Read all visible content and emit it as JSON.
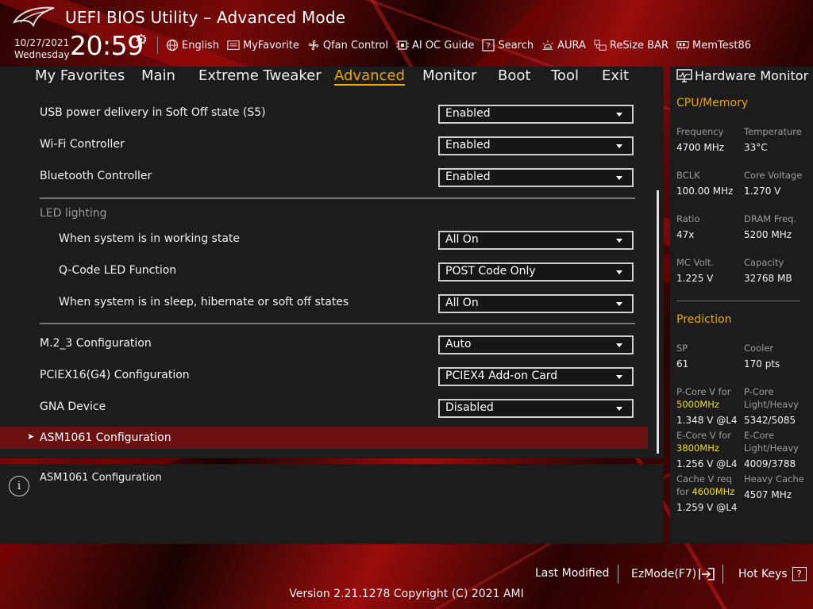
{
  "app": {
    "title": "UEFI BIOS Utility – Advanced Mode"
  },
  "datetime": {
    "date": "10/27/2021",
    "day": "Wednesday",
    "time": "20:59"
  },
  "toolbar": [
    {
      "label": "English",
      "icon": "globe-icon"
    },
    {
      "label": "MyFavorite",
      "icon": "favorite-list-icon"
    },
    {
      "label": "Qfan Control",
      "icon": "fan-icon"
    },
    {
      "label": "AI OC Guide",
      "icon": "chip-icon"
    },
    {
      "label": "Search",
      "icon": "search-help-icon"
    },
    {
      "label": "AURA",
      "icon": "aura-light-icon"
    },
    {
      "label": "ReSize BAR",
      "icon": "resize-bar-icon"
    },
    {
      "label": "MemTest86",
      "icon": "memory-icon"
    }
  ],
  "tabs": [
    {
      "label": "My Favorites",
      "active": false
    },
    {
      "label": "Main",
      "active": false
    },
    {
      "label": "Extreme Tweaker",
      "active": false
    },
    {
      "label": "Advanced",
      "active": true
    },
    {
      "label": "Monitor",
      "active": false
    },
    {
      "label": "Boot",
      "active": false
    },
    {
      "label": "Tool",
      "active": false
    },
    {
      "label": "Exit",
      "active": false
    }
  ],
  "settings": {
    "usb_pd": {
      "label": "USB power delivery in Soft Off state (S5)",
      "value": "Enabled"
    },
    "wifi": {
      "label": "Wi-Fi Controller",
      "value": "Enabled"
    },
    "bluetooth": {
      "label": "Bluetooth Controller",
      "value": "Enabled"
    },
    "led_section": "LED lighting",
    "led_working": {
      "label": "When system is in working state",
      "value": "All On"
    },
    "qcode_led": {
      "label": "Q-Code LED Function",
      "value": "POST Code Only"
    },
    "led_sleep": {
      "label": "When system is in sleep, hibernate or soft off states",
      "value": "All On"
    },
    "m2_3": {
      "label": "M.2_3 Configuration",
      "value": "Auto"
    },
    "pciex16": {
      "label": "PCIEX16(G4) Configuration",
      "value": "PCIEX4 Add-on Card"
    },
    "gna": {
      "label": "GNA Device",
      "value": "Disabled"
    },
    "asm1061": {
      "label": "ASM1061 Configuration"
    }
  },
  "help": {
    "text": "ASM1061 Configuration"
  },
  "hardware_monitor": {
    "title": "Hardware Monitor",
    "cpu_memory": {
      "heading": "CPU/Memory",
      "frequency": {
        "label": "Frequency",
        "value": "4700 MHz"
      },
      "temperature": {
        "label": "Temperature",
        "value": "33°C"
      },
      "bclk": {
        "label": "BCLK",
        "value": "100.00 MHz"
      },
      "core_voltage": {
        "label": "Core Voltage",
        "value": "1.270 V"
      },
      "ratio": {
        "label": "Ratio",
        "value": "47x"
      },
      "dram_freq": {
        "label": "DRAM Freq.",
        "value": "5200 MHz"
      },
      "mc_volt": {
        "label": "MC Volt.",
        "value": "1.225 V"
      },
      "capacity": {
        "label": "Capacity",
        "value": "32768 MB"
      }
    },
    "prediction": {
      "heading": "Prediction",
      "sp": {
        "label": "SP",
        "value": "61"
      },
      "cooler": {
        "label": "Cooler",
        "value": "170 pts"
      },
      "pcore_v": {
        "label_1": "P-Core V for",
        "label_freq": "5000MHz",
        "value": "1.348 V @L4"
      },
      "pcore_lh": {
        "label_1": "P-Core",
        "label_2": "Light/Heavy",
        "value": "5342/5085"
      },
      "ecore_v": {
        "label_1": "E-Core V for",
        "label_freq": "3800MHz",
        "value": "1.256 V @L4"
      },
      "ecore_lh": {
        "label_1": "E-Core",
        "label_2": "Light/Heavy",
        "value": "4009/3788"
      },
      "cache_v": {
        "label_1": "Cache V req",
        "label_2": "for",
        "label_freq": "4600MHz",
        "value": "1.259 V @L4"
      },
      "heavy_cache": {
        "label": "Heavy Cache",
        "value": "4507 MHz"
      }
    }
  },
  "footer": {
    "last_modified": "Last Modified",
    "ezmode": "EzMode(F7)",
    "hotkeys": "Hot Keys",
    "hotkeys_glyph": "?",
    "version": "Version 2.21.1278 Copyright (C) 2021 AMI"
  },
  "colors": {
    "accent": "#e8a800",
    "highlight_row": "#6a1010",
    "prediction_freq": "#f0e000"
  }
}
